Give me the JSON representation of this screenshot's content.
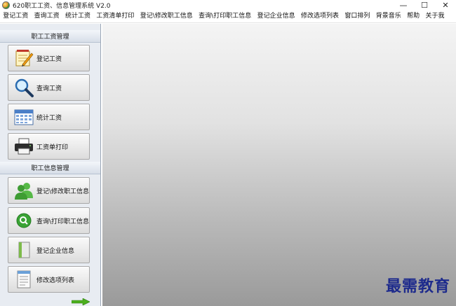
{
  "window": {
    "title": "620职工工资、信息管理系统 V2.0",
    "minimize": "—",
    "maximize": "☐",
    "close": "✕"
  },
  "menu": [
    "登记工资",
    "查询工资",
    "统计工资",
    "工资清单打印",
    "登记\\修改职工信息",
    "查询\\打印职工信息",
    "登记企业信息",
    "修改选项列表",
    "窗口排列",
    "背景音乐",
    "帮助",
    "关于我"
  ],
  "sidebar": {
    "section1": "职工工资管理",
    "section2": "职工信息管理",
    "buttons": [
      {
        "label": "登记工资",
        "icon": "notepad-pencil-icon"
      },
      {
        "label": "查询工资",
        "icon": "magnifier-icon"
      },
      {
        "label": "统计工资",
        "icon": "calendar-table-icon"
      },
      {
        "label": "工资单打印",
        "icon": "printer-icon"
      },
      {
        "label": "登记\\修改职工信息",
        "icon": "users-icon"
      },
      {
        "label": "查询\\打印职工信息",
        "icon": "search-badge-icon"
      },
      {
        "label": "登记企业信息",
        "icon": "book-icon"
      },
      {
        "label": "修改选项列表",
        "icon": "list-doc-icon"
      }
    ]
  },
  "watermark": "最需教育",
  "colors": {
    "sidebar_bg": "#e8ecf2",
    "watermark": "#1d2a8c",
    "arrow": "#4caf1e"
  }
}
